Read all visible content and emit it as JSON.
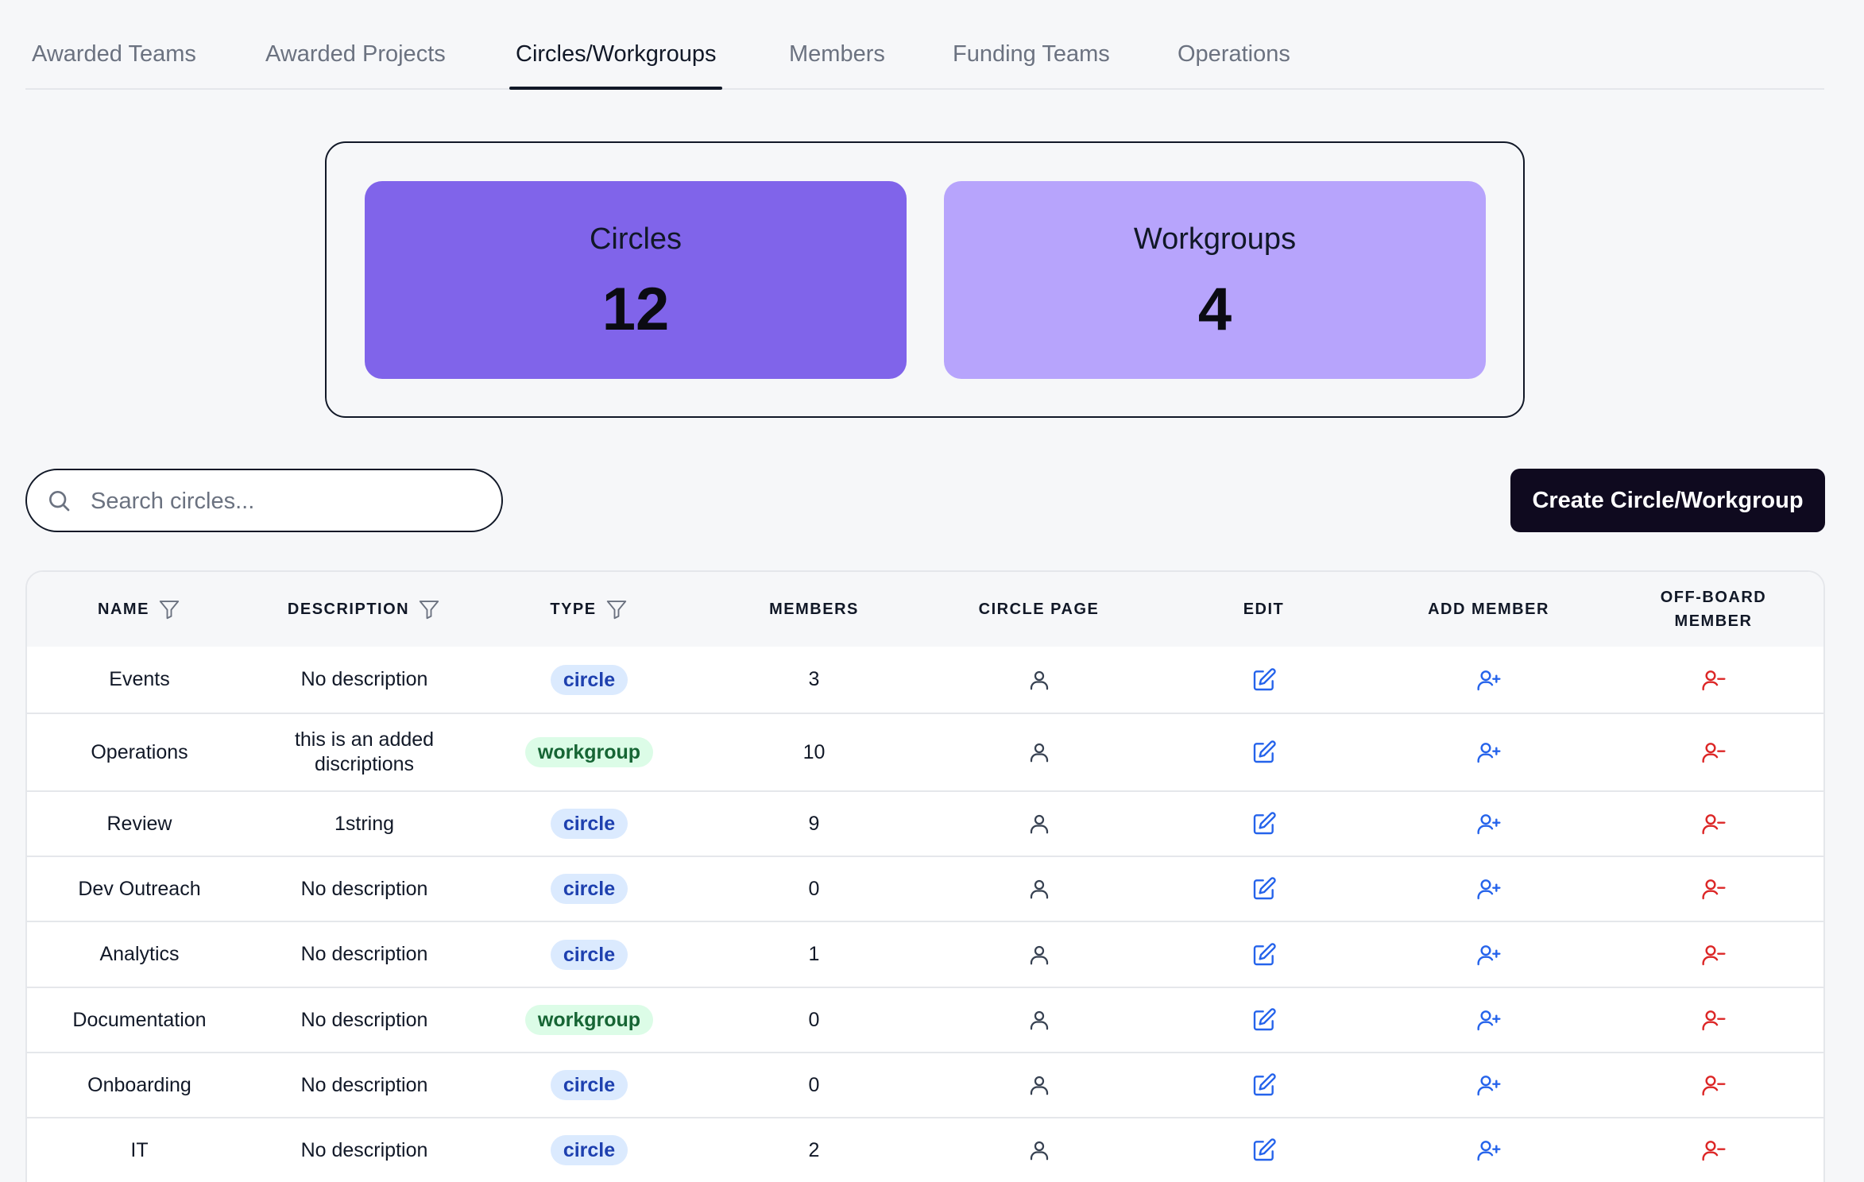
{
  "tabs": [
    {
      "label": "Awarded Teams"
    },
    {
      "label": "Awarded Projects"
    },
    {
      "label": "Circles/Workgroups"
    },
    {
      "label": "Members"
    },
    {
      "label": "Funding Teams"
    },
    {
      "label": "Operations"
    }
  ],
  "active_tab": "Circles/Workgroups",
  "stats": {
    "circles": {
      "label": "Circles",
      "value": "12"
    },
    "workgroups": {
      "label": "Workgroups",
      "value": "4"
    }
  },
  "search": {
    "placeholder": "Search circles..."
  },
  "create_button": "Create Circle/Workgroup",
  "table": {
    "headers": {
      "name": "NAME",
      "description": "DESCRIPTION",
      "type": "TYPE",
      "members": "MEMBERS",
      "circle_page": "CIRCLE PAGE",
      "edit": "EDIT",
      "add_member": "ADD MEMBER",
      "offboard_line1": "OFF-BOARD",
      "offboard_line2": "MEMBER"
    },
    "rows": [
      {
        "name": "Events",
        "description": "No description",
        "type": "circle",
        "members": "3"
      },
      {
        "name": "Operations",
        "description": "this is an added discriptions",
        "type": "workgroup",
        "members": "10"
      },
      {
        "name": "Review",
        "description": "1string",
        "type": "circle",
        "members": "9"
      },
      {
        "name": "Dev Outreach",
        "description": "No description",
        "type": "circle",
        "members": "0"
      },
      {
        "name": "Analytics",
        "description": "No description",
        "type": "circle",
        "members": "1"
      },
      {
        "name": "Documentation",
        "description": "No description",
        "type": "workgroup",
        "members": "0"
      },
      {
        "name": "Onboarding",
        "description": "No description",
        "type": "circle",
        "members": "0"
      },
      {
        "name": "IT",
        "description": "No description",
        "type": "circle",
        "members": "2"
      }
    ]
  },
  "icons": {
    "search": "search-icon",
    "filter": "filter-icon",
    "circle_page": "user-icon",
    "edit": "edit-icon",
    "add_member": "user-plus-icon",
    "offboard": "user-minus-icon"
  },
  "colors": {
    "accent_circles": "#8064ea",
    "accent_workgroups": "#b7a4fc",
    "primary_button": "#0f0a1f",
    "edit_icon": "#2563eb",
    "add_icon": "#2563eb",
    "offboard_icon": "#dc2626",
    "circle_badge_bg": "#dbeafe",
    "workgroup_badge_bg": "#dcfce7"
  }
}
